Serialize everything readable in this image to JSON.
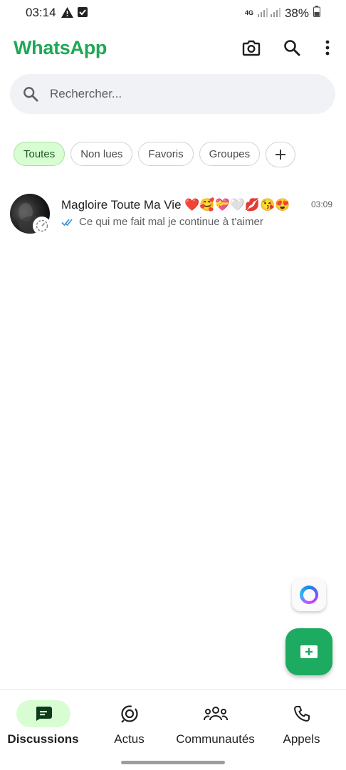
{
  "status_bar": {
    "time": "03:14",
    "network": "4G",
    "battery": "38%"
  },
  "header": {
    "title": "WhatsApp",
    "brand_color": "#1fa855",
    "icons": [
      "camera-icon",
      "search-icon",
      "more-vert-icon"
    ]
  },
  "search": {
    "placeholder": "Rechercher...",
    "value": ""
  },
  "filters": {
    "chips": [
      "Toutes",
      "Non lues",
      "Favoris",
      "Groupes"
    ],
    "active": "Toutes",
    "add_icon": "plus-icon"
  },
  "chats": [
    {
      "name": "Magloire Toute Ma Vie ❤️🥰💝🤍💋😘😍",
      "time": "03:09",
      "preview": "Ce qui me fait mal je continue à t'aimer",
      "status_icon": "double-check-icon",
      "avatar_badge_icon": "status-timer-icon"
    }
  ],
  "fabs": {
    "meta_ai_icon": "meta-ai-icon",
    "new_chat_icon": "new-chat-icon",
    "accent": "#1daa61"
  },
  "bottom_nav": {
    "items": [
      {
        "label": "Discussions",
        "icon": "chats-icon",
        "active": true
      },
      {
        "label": "Actus",
        "icon": "updates-icon",
        "active": false
      },
      {
        "label": "Communautés",
        "icon": "communities-icon",
        "active": false
      },
      {
        "label": "Appels",
        "icon": "phone-icon",
        "active": false
      }
    ],
    "active_color": "#d8fdd2"
  }
}
